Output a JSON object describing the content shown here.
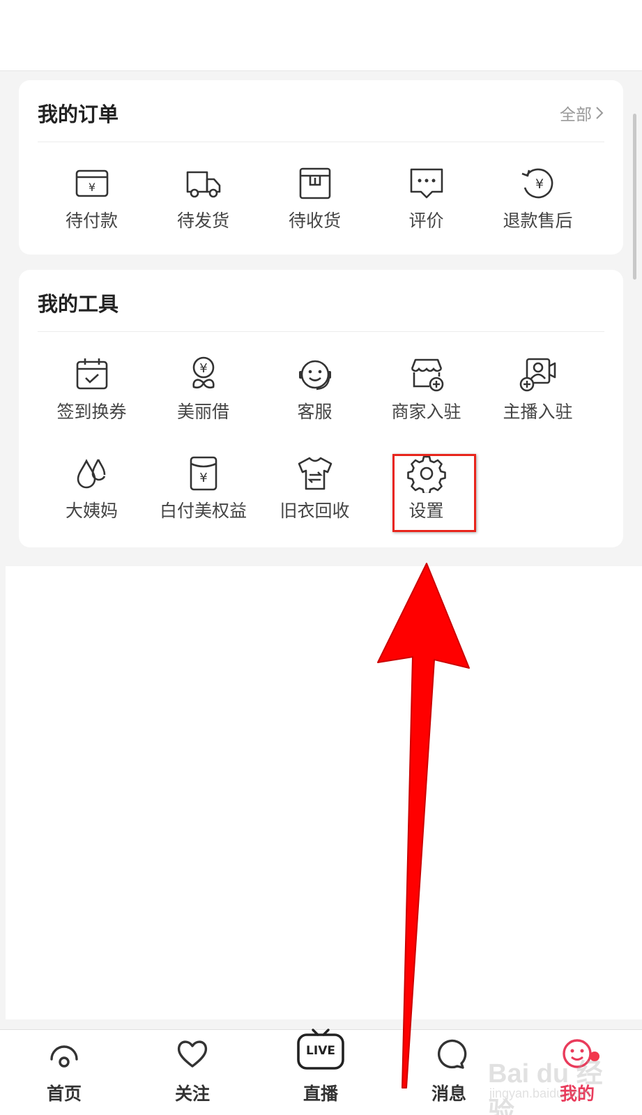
{
  "orders": {
    "title": "我的订单",
    "all_link": "全部",
    "items": [
      {
        "label": "待付款",
        "icon": "pending-payment-icon"
      },
      {
        "label": "待发货",
        "icon": "delivery-truck-icon"
      },
      {
        "label": "待收货",
        "icon": "package-box-icon"
      },
      {
        "label": "评价",
        "icon": "comment-bubble-icon"
      },
      {
        "label": "退款售后",
        "icon": "refund-icon"
      }
    ]
  },
  "tools": {
    "title": "我的工具",
    "items": [
      {
        "label": "签到换券",
        "icon": "calendar-check-icon"
      },
      {
        "label": "美丽借",
        "icon": "money-flower-icon"
      },
      {
        "label": "客服",
        "icon": "customer-service-icon"
      },
      {
        "label": "商家入驻",
        "icon": "shop-add-icon"
      },
      {
        "label": "主播入驻",
        "icon": "streamer-add-icon"
      },
      {
        "label": "大姨妈",
        "icon": "droplets-icon"
      },
      {
        "label": "白付美权益",
        "icon": "yen-card-icon"
      },
      {
        "label": "旧衣回收",
        "icon": "shirt-recycle-icon"
      },
      {
        "label": "设置",
        "icon": "gear-icon"
      }
    ]
  },
  "tabbar": {
    "items": [
      {
        "label": "首页",
        "icon": "home-icon"
      },
      {
        "label": "关注",
        "icon": "heart-icon"
      },
      {
        "label": "直播",
        "icon": "live-tv-icon",
        "badge": "LIVE"
      },
      {
        "label": "消息",
        "icon": "message-icon"
      },
      {
        "label": "我的",
        "icon": "profile-face-icon",
        "active": true
      }
    ]
  },
  "watermark": {
    "main": "Bai du 经验",
    "sub": "jingyan.baidu.com"
  },
  "colors": {
    "accent": "#e93b5b",
    "highlight": "#e8251c",
    "arrow": "#ff0000",
    "badge_dot": "#f2374c"
  }
}
